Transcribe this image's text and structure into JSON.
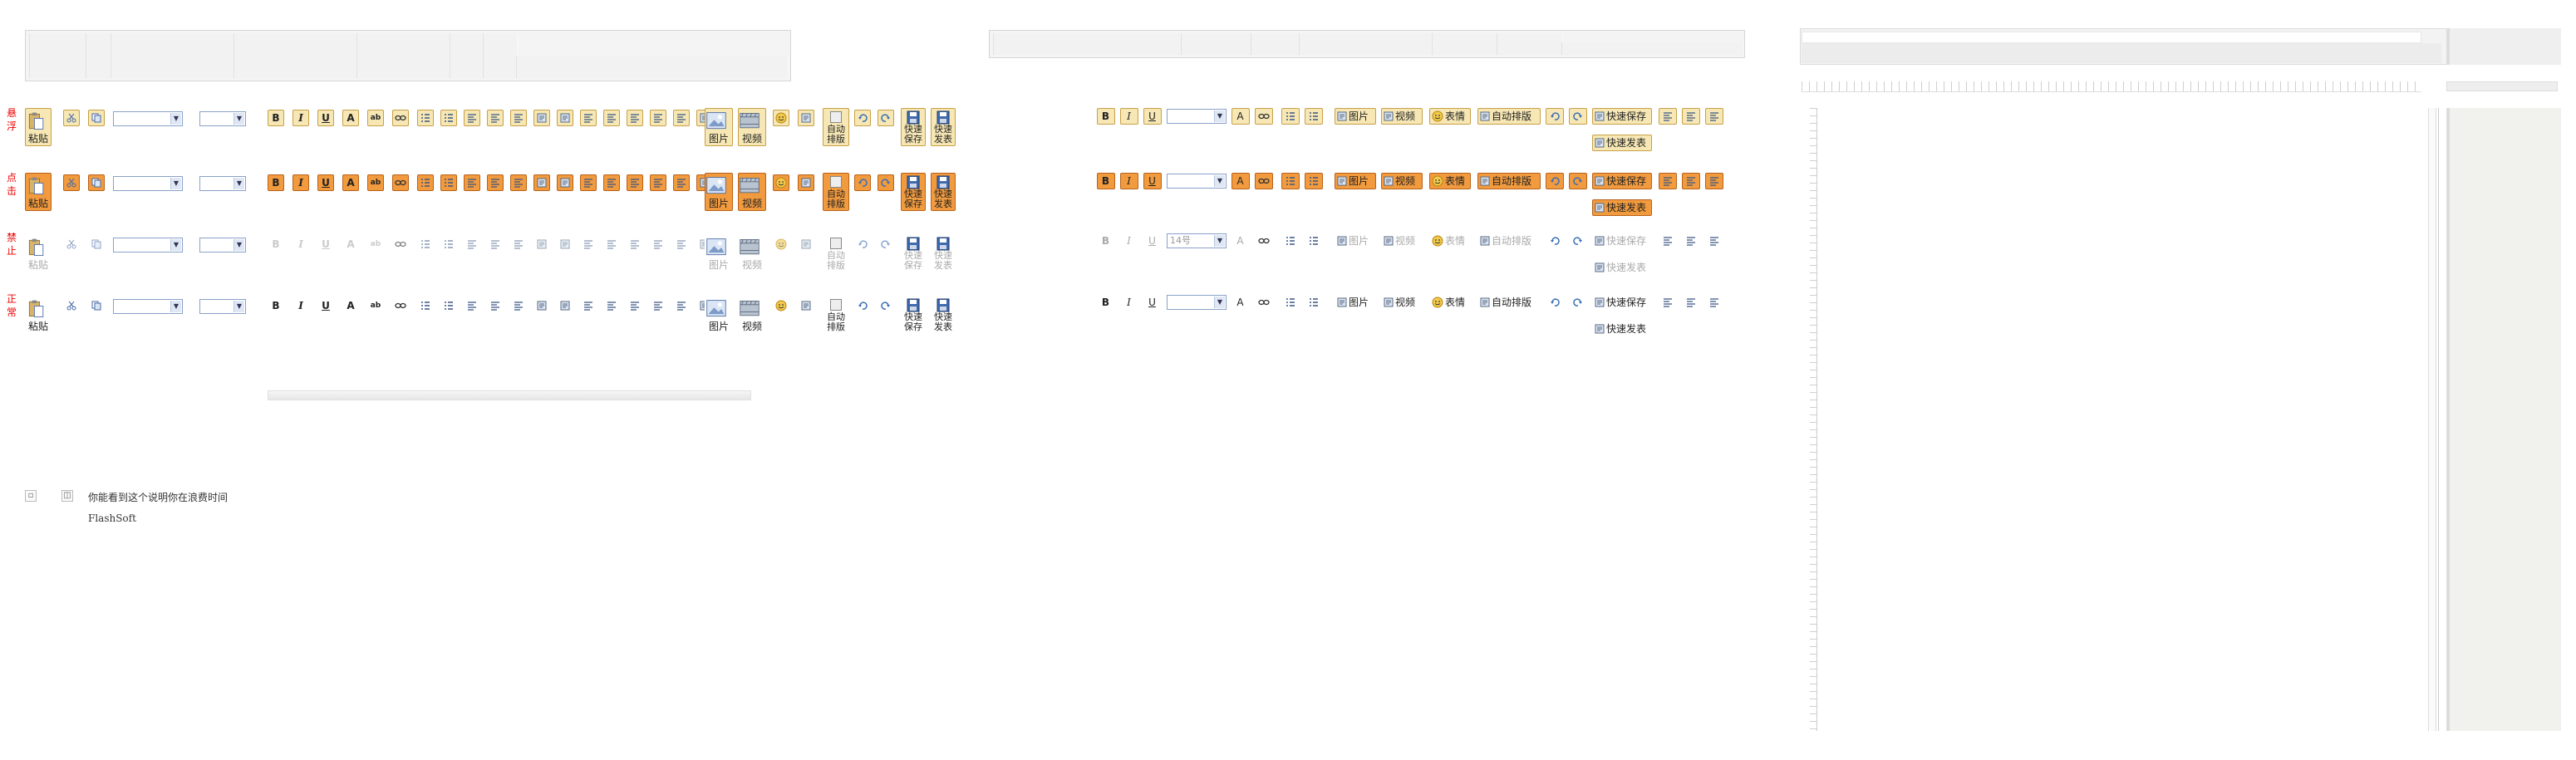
{
  "states": {
    "hover": "悬浮",
    "click": "点击",
    "disabled": "禁止",
    "normal": "正常"
  },
  "toolbar": {
    "paste_label": "粘贴",
    "image_label": "图片",
    "video_label": "视频",
    "auto_format_label": "自动排版",
    "quick_save_label": "快速保存",
    "quick_publish_label": "快速发表",
    "emoticon_label": "表情",
    "font_size_value": "14号"
  },
  "status": {
    "message": "你能看到这个说明你在浪费时间",
    "brand": "FlashSoft"
  },
  "colors": {
    "hover_bg": "#f6e7b4",
    "click_bg": "#f19a3e",
    "state_label": "#e00000"
  }
}
